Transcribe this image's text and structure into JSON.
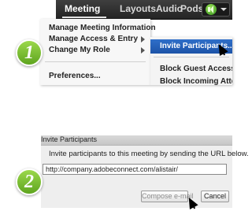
{
  "menubar": {
    "items": [
      "Meeting",
      "Layouts",
      "Pods",
      "Audio"
    ]
  },
  "dropdown": {
    "items": [
      "Manage Meeting Information",
      "Manage Access & Entry",
      "Change My Role",
      "Preferences..."
    ]
  },
  "submenu": {
    "highlighted": "Invite Participants...",
    "items": [
      "Block Guest Access",
      "Block Incoming Attendees"
    ]
  },
  "dialog": {
    "title": "Invite Participants",
    "instruction": "Invite participants to this meeting by sending the URL below.",
    "url": "http://company.adobeconnect.com/alistair/",
    "compose_label": "Compose e-mail",
    "cancel_label": "Cancel"
  },
  "badges": [
    "1",
    "2"
  ],
  "colors": {
    "menubar": "#2b2b2b",
    "highlight": "#2462bd",
    "badge": "#7cc235"
  },
  "icons": [
    "speaker-icon",
    "dropdown-arrow-icon",
    "submenu-arrow-icon",
    "mouse-cursor-icon"
  ]
}
